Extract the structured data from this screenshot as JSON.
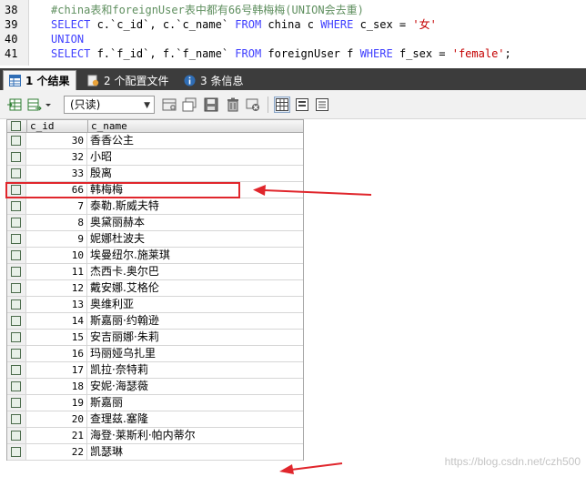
{
  "editor": {
    "lines": [
      {
        "number": "38",
        "segments": [
          {
            "t": "#china表和foreignUser表中都有66号韩梅梅(UNION会去重)",
            "c": "cm"
          }
        ]
      },
      {
        "number": "39",
        "segments": [
          {
            "t": "SELECT ",
            "c": "kw"
          },
          {
            "t": "c.`c_id`, c.`c_name` ",
            "c": "id"
          },
          {
            "t": "FROM ",
            "c": "kw"
          },
          {
            "t": "china c ",
            "c": "id"
          },
          {
            "t": "WHERE ",
            "c": "kw"
          },
          {
            "t": "c_sex = ",
            "c": "id"
          },
          {
            "t": "'女'",
            "c": "str"
          }
        ]
      },
      {
        "number": "40",
        "segments": [
          {
            "t": "UNION",
            "c": "kw"
          }
        ]
      },
      {
        "number": "41",
        "segments": [
          {
            "t": "SELECT ",
            "c": "kw"
          },
          {
            "t": "f.`f_id`, f.`f_name` ",
            "c": "id"
          },
          {
            "t": "FROM ",
            "c": "kw"
          },
          {
            "t": "foreignUser f ",
            "c": "id"
          },
          {
            "t": "WHERE ",
            "c": "kw"
          },
          {
            "t": "f_sex = ",
            "c": "id"
          },
          {
            "t": "'female'",
            "c": "str"
          },
          {
            "t": ";",
            "c": "id"
          }
        ]
      }
    ]
  },
  "tabs": [
    {
      "label": "1 个结果",
      "active": true,
      "icon": "table-result-icon"
    },
    {
      "label": "2 个配置文件",
      "active": false,
      "icon": "profile-icon"
    },
    {
      "label": "3 条信息",
      "active": false,
      "icon": "info-icon"
    }
  ],
  "toolbar": {
    "mode_select_value": "(只读)"
  },
  "grid": {
    "columns": [
      "c_id",
      "c_name"
    ],
    "rows": [
      [
        "30",
        "香香公主"
      ],
      [
        "32",
        "小昭"
      ],
      [
        "33",
        "殷离"
      ],
      [
        "66",
        "韩梅梅"
      ],
      [
        "7",
        "泰勒.斯威夫特"
      ],
      [
        "8",
        "奥黛丽赫本"
      ],
      [
        "9",
        "妮娜杜波夫"
      ],
      [
        "10",
        "埃曼纽尔.施莱琪"
      ],
      [
        "11",
        "杰西卡.奥尔巴"
      ],
      [
        "12",
        "戴安娜.艾格伦"
      ],
      [
        "13",
        "奥维利亚"
      ],
      [
        "14",
        "斯嘉丽·约翰逊"
      ],
      [
        "15",
        "安吉丽娜·朱莉"
      ],
      [
        "16",
        "玛丽娅乌扎里"
      ],
      [
        "17",
        "凯拉·奈特莉"
      ],
      [
        "18",
        "安妮·海瑟薇"
      ],
      [
        "19",
        "斯嘉丽"
      ],
      [
        "20",
        "查理兹.塞隆"
      ],
      [
        "21",
        "海登·莱斯利·帕内蒂尔"
      ],
      [
        "22",
        "凯瑟琳"
      ]
    ]
  },
  "watermark": "https://blog.csdn.net/czh500",
  "colors": {
    "annotation": "#e0262c",
    "keyword": "#4040ff",
    "comment": "#5f8f5f",
    "string": "#c40000"
  }
}
